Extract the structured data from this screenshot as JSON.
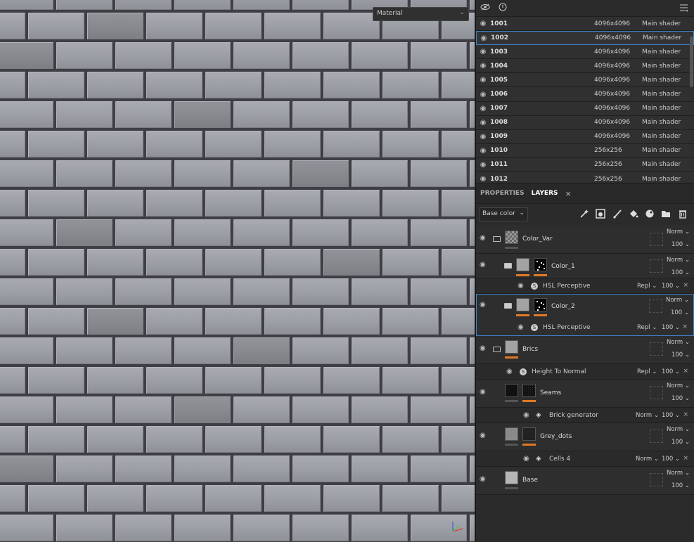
{
  "viewport": {
    "material_select": "Material"
  },
  "textures": {
    "rows": [
      {
        "name": "1001",
        "resolution": "4096x4096",
        "shader": "Main shader",
        "selected": false
      },
      {
        "name": "1002",
        "resolution": "4096x4096",
        "shader": "Main shader",
        "selected": true
      },
      {
        "name": "1003",
        "resolution": "4096x4096",
        "shader": "Main shader",
        "selected": false
      },
      {
        "name": "1004",
        "resolution": "4096x4096",
        "shader": "Main shader",
        "selected": false
      },
      {
        "name": "1005",
        "resolution": "4096x4096",
        "shader": "Main shader",
        "selected": false
      },
      {
        "name": "1006",
        "resolution": "4096x4096",
        "shader": "Main shader",
        "selected": false
      },
      {
        "name": "1007",
        "resolution": "4096x4096",
        "shader": "Main shader",
        "selected": false
      },
      {
        "name": "1008",
        "resolution": "4096x4096",
        "shader": "Main shader",
        "selected": false
      },
      {
        "name": "1009",
        "resolution": "4096x4096",
        "shader": "Main shader",
        "selected": false
      },
      {
        "name": "1010",
        "resolution": "256x256",
        "shader": "Main shader",
        "selected": false
      },
      {
        "name": "1011",
        "resolution": "256x256",
        "shader": "Main shader",
        "selected": false
      },
      {
        "name": "1012",
        "resolution": "256x256",
        "shader": "Main shader",
        "selected": false
      }
    ]
  },
  "tabs": {
    "properties": "PROPERTIES",
    "layers": "LAYERS",
    "close": "×"
  },
  "channel_select": "Base color",
  "layers": {
    "color_var": {
      "name": "Color_Var",
      "blend": "Norm",
      "opacity": "100"
    },
    "color_1": {
      "name": "Color_1",
      "blend": "Norm",
      "opacity": "100",
      "fx": {
        "name": "HSL Perceptive",
        "blend": "Repl",
        "opacity": "100"
      }
    },
    "color_2": {
      "name": "Color_2",
      "blend": "Norm",
      "opacity": "100",
      "fx": {
        "name": "HSL Perceptive",
        "blend": "Repl",
        "opacity": "100"
      }
    },
    "brics": {
      "name": "Brics",
      "blend": "Norm",
      "opacity": "100",
      "fx": {
        "name": "Height To Normal",
        "blend": "Repl",
        "opacity": "100"
      }
    },
    "seams": {
      "name": "Seams",
      "blend": "Norm",
      "opacity": "100",
      "fx": {
        "name": "Brick generator",
        "blend": "Norm",
        "opacity": "100"
      }
    },
    "grey_dots": {
      "name": "Grey_dots",
      "blend": "Norm",
      "opacity": "100",
      "fx": {
        "name": "Cells 4",
        "blend": "Norm",
        "opacity": "100"
      }
    },
    "base": {
      "name": "Base",
      "blend": "Norm",
      "opacity": "100"
    }
  },
  "colors": {
    "accent": "#e07a25",
    "selection": "#3e84c9"
  }
}
